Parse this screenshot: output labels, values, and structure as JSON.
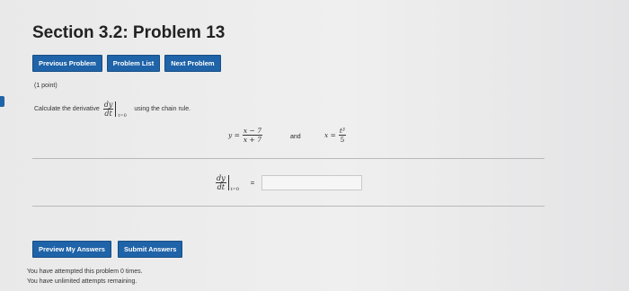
{
  "page": {
    "title": "Section 3.2: Problem 13"
  },
  "nav": {
    "previous": "Previous Problem",
    "list": "Problem List",
    "next": "Next Problem"
  },
  "problem": {
    "points": "(1 point)",
    "prompt_prefix": "Calculate the derivative",
    "prompt_suffix": "using the chain rule.",
    "deriv_num": "dy",
    "deriv_den": "dt",
    "eval_at": "t=0",
    "y_label": "y =",
    "y_num": "x − 7",
    "y_den": "x + 7",
    "and_text": "and",
    "x_label": "x =",
    "x_num": "t³",
    "x_den": "5",
    "equals": "=",
    "answer_value": ""
  },
  "actions": {
    "preview": "Preview My Answers",
    "submit": "Submit Answers"
  },
  "status": {
    "attempted": "You have attempted this problem 0 times.",
    "remaining": "You have unlimited attempts remaining."
  },
  "colors": {
    "button": "#1f63a8"
  }
}
